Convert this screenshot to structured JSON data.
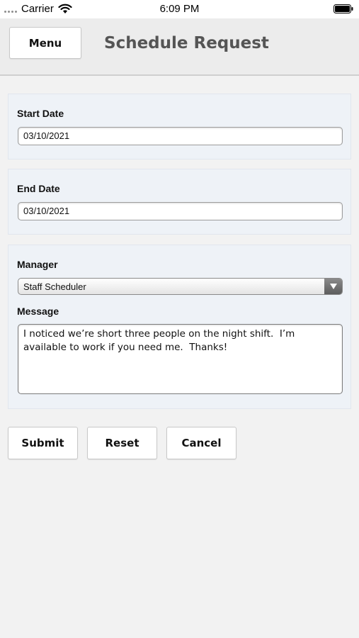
{
  "status_bar": {
    "carrier": "Carrier",
    "time": "6:09 PM"
  },
  "header": {
    "menu_label": "Menu",
    "title": "Schedule Request"
  },
  "form": {
    "start_date": {
      "label": "Start Date",
      "value": "03/10/2021"
    },
    "end_date": {
      "label": "End Date",
      "value": "03/10/2021"
    },
    "manager": {
      "label": "Manager",
      "selected": "Staff Scheduler"
    },
    "message": {
      "label": "Message",
      "value": "I noticed we’re short three people on the night shift.  I’m available to work if you need me.  Thanks!"
    }
  },
  "actions": {
    "submit_label": "Submit",
    "reset_label": "Reset",
    "cancel_label": "Cancel"
  },
  "icons": {
    "wifi": "wifi-icon",
    "battery": "battery-icon",
    "dropdown": "chevron-down-icon"
  },
  "colors": {
    "panel_background": "#eef2f7",
    "page_background": "#f2f2f2",
    "title_color": "#555555"
  }
}
